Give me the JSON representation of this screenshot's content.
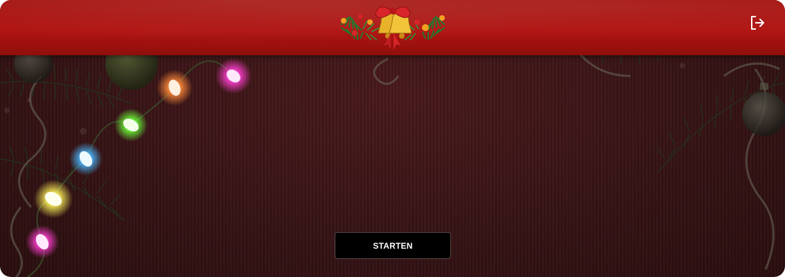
{
  "header": {
    "logo_icon": "christmas-bells-icon",
    "exit_icon": "logout-icon"
  },
  "main": {
    "start_label": "STARTEN"
  },
  "colors": {
    "header_red": "#b01310",
    "background_dark_red": "#3a1517",
    "button_black": "#000000",
    "bulb_pink": "#ff3fd0",
    "bulb_orange": "#ff8a3a",
    "bulb_green": "#6cff3a",
    "bulb_blue": "#4ab8ff",
    "bulb_yellow": "#fff25a"
  }
}
